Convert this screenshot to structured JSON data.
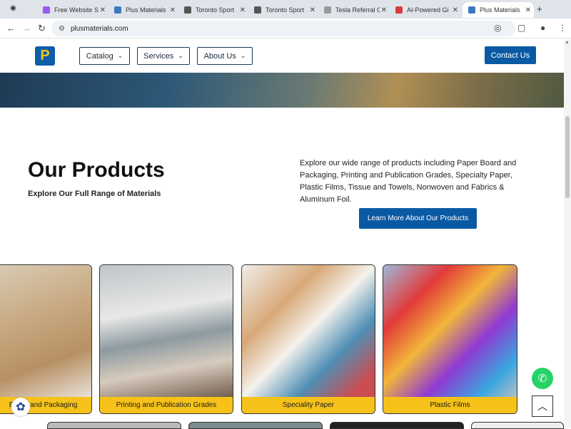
{
  "browser": {
    "tabs": [
      {
        "title": "Free Website S",
        "color": "#9b59f5"
      },
      {
        "title": "Plus Materials",
        "color": "#3c79c2"
      },
      {
        "title": "Toronto Sport",
        "color": "#555555"
      },
      {
        "title": "Toronto Sport",
        "color": "#555555"
      },
      {
        "title": "Tesla Referral C",
        "color": "#999999"
      },
      {
        "title": "AI-Powered Gi",
        "color": "#d93b3b"
      },
      {
        "title": "Plus Materials",
        "color": "#3c79c2"
      }
    ],
    "url": "plusmaterials.com"
  },
  "header": {
    "logo_text": "P",
    "menu": [
      {
        "label": "Catalog"
      },
      {
        "label": "Services"
      },
      {
        "label": "About Us"
      }
    ],
    "contact_label": "Contact Us"
  },
  "products": {
    "title": "Our Products",
    "subtitle": "Explore Our Full Range of Materials",
    "description": "Explore our wide range of products including Paper Board and Packaging, Printing and Publication Grades, Specialty Paper, Plastic Films, Tissue and Towels, Nonwoven and Fabrics & Aluminum Foil.",
    "cta_label": "Learn More About Our Products",
    "cards": [
      {
        "label": "Board and Packaging"
      },
      {
        "label": "Printing and Publication Grades"
      },
      {
        "label": "Speciality Paper"
      },
      {
        "label": "Plastic Films"
      }
    ]
  }
}
